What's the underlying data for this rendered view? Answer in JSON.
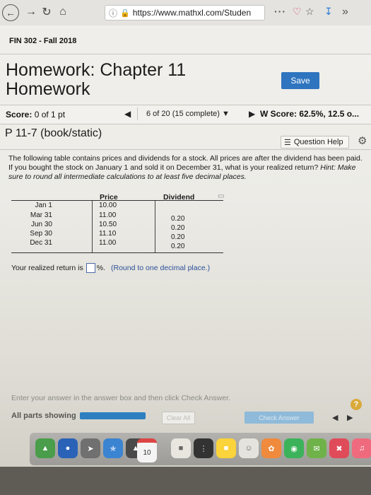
{
  "browser": {
    "url": "https://www.mathxl.com/Studen",
    "back_icon": "arrow-left-icon",
    "forward_icon": "arrow-right-icon",
    "reload_icon": "reload-icon",
    "home_icon": "home-icon"
  },
  "course": {
    "name": "FIN 302 - Fall 2018"
  },
  "header": {
    "title_line1": "Homework: Chapter 11",
    "title_line2": "Homework",
    "save_label": "Save"
  },
  "scorebar": {
    "score_label": "Score:",
    "score_value": "0 of 1 pt",
    "question_count": "6 of 20 (15 complete)",
    "hw_score": "W Score: 62.5%, 12.5 o..."
  },
  "question": {
    "id": "P 11-7 (book/static)",
    "help_label": "Question Help",
    "prompt": "The following table contains prices and dividends for a stock. All prices are after the dividend has been paid. If you bought the stock on January 1 and sold it on December 31, what is your realized return?",
    "hint_label": "Hint:",
    "hint_text": "Make sure to round all intermediate calculations to at least five decimal places.",
    "table": {
      "headers": {
        "price": "Price",
        "dividend": "Dividend"
      },
      "rows": [
        {
          "date": "Jan 1",
          "price": "10.00",
          "dividend": ""
        },
        {
          "date": "Mar 31",
          "price": "11.00",
          "dividend": "0.20"
        },
        {
          "date": "Jun 30",
          "price": "10.50",
          "dividend": "0.20"
        },
        {
          "date": "Sep 30",
          "price": "11.10",
          "dividend": "0.20"
        },
        {
          "date": "Dec 31",
          "price": "11.00",
          "dividend": "0.20"
        }
      ]
    },
    "answer_prefix": "Your realized return is",
    "answer_value": "",
    "answer_suffix": "%.",
    "answer_hint": "(Round to one decimal place.)"
  },
  "footer": {
    "instruction": "Enter your answer in the answer box and then click Check Answer.",
    "parts_label": "All parts showing",
    "progress_fraction": 1.0,
    "clear_label": "Clear All",
    "check_label": "Check Answer"
  },
  "dock": {
    "calendar_day": "10"
  }
}
